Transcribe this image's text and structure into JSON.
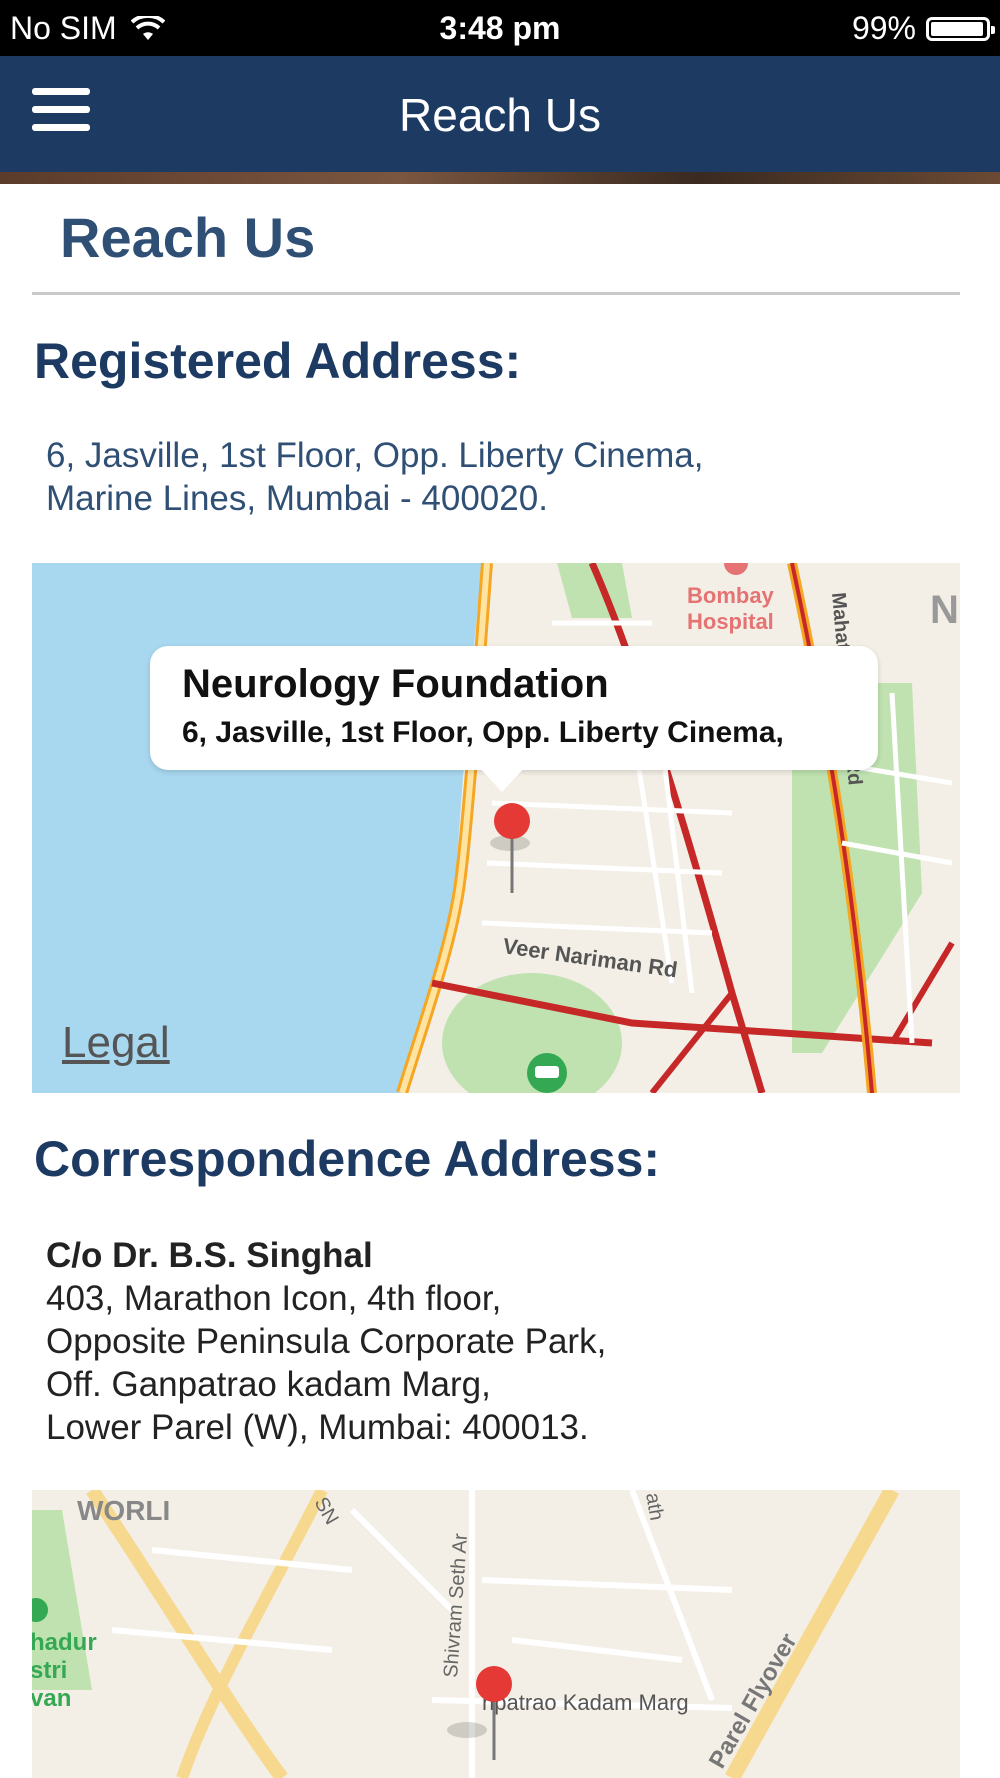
{
  "status_bar": {
    "carrier": "No SIM",
    "time": "3:48 pm",
    "battery": "99%"
  },
  "nav": {
    "title": "Reach Us"
  },
  "page": {
    "title": "Reach Us"
  },
  "registered": {
    "heading": "Registered Address:",
    "line1": "6, Jasville, 1st Floor, Opp. Liberty Cinema,",
    "line2": "Marine Lines, Mumbai - 400020."
  },
  "map1": {
    "callout_title": "Neurology Foundation",
    "callout_subtitle": "6, Jasville, 1st Floor, Opp. Liberty Cinema,",
    "legal": "Legal",
    "label_hospital_1": "Bombay",
    "label_hospital_2": "Hospital",
    "label_road_1": "Veer Nariman Rd",
    "label_road_2": "Mahatma Gandhi Rd",
    "label_letter": "N"
  },
  "correspondence": {
    "heading": "Correspondence Address:",
    "name": "C/o Dr. B.S. Singhal",
    "line1": "403, Marathon Icon, 4th floor,",
    "line2": "Opposite Peninsula Corporate Park,",
    "line3": "Off. Ganpatrao kadam Marg,",
    "line4": "Lower Parel (W), Mumbai: 400013."
  },
  "map2": {
    "label_area": "WORLI",
    "label_road_1": "npatrao Kadam Marg",
    "label_road_2": "Parel Flyover",
    "label_road_3": "Shivram Seth Ar",
    "label_park_1": "hadur",
    "label_park_2": "stri",
    "label_park_3": "van",
    "label_sn": "SN",
    "label_ath": "ath"
  },
  "colors": {
    "navbar": "#1d3a63",
    "heading": "#1d3a63",
    "water": "#a8d8f0",
    "pin": "#e53935"
  }
}
